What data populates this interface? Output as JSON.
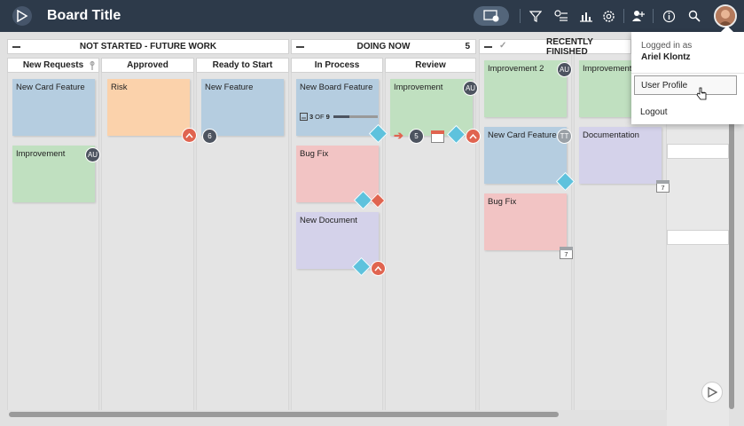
{
  "header": {
    "title": "Board Title",
    "icons": [
      "logo-icon",
      "board-view-icon",
      "filter-icon",
      "list-filter-icon",
      "analytics-icon",
      "settings-icon",
      "add-user-icon",
      "info-icon",
      "search-icon"
    ]
  },
  "lanes": [
    {
      "name": "NOT STARTED - FUTURE WORK",
      "count": ""
    },
    {
      "name": "DOING NOW",
      "count": "5"
    },
    {
      "name": "RECENTLY FINISHED",
      "count": ""
    }
  ],
  "columns": [
    {
      "name": "New Requests"
    },
    {
      "name": "Approved"
    },
    {
      "name": "Ready to Start"
    },
    {
      "name": "In Process"
    },
    {
      "name": "Review"
    }
  ],
  "cards": {
    "new_card_feature_1": "New Card Feature",
    "improvement_1": "Improvement",
    "risk": "Risk",
    "new_feature": "New Feature",
    "new_board_feature": "New Board Feature",
    "bug_fix_1": "Bug Fix",
    "new_document": "New Document",
    "improvement_review": "Improvement",
    "improvement_2": "Improvement 2",
    "improvement_partial": "Improvement",
    "new_card_feature_2": "New Card Feature",
    "documentation": "Documentation",
    "bug_fix_2": "Bug Fix"
  },
  "badges": {
    "au1": "AU",
    "au2": "AU",
    "au3": "AU",
    "tt": "TT",
    "count6": "6",
    "count5": "5",
    "cal7a": "7",
    "cal7b": "7"
  },
  "progress": {
    "done": "3",
    "of": "OF",
    "total": "9"
  },
  "user_menu": {
    "logged_in_as": "Logged in as",
    "user_name": "Ariel Klontz",
    "items": [
      "User Profile",
      "Logout"
    ]
  },
  "colors": {
    "topbar": "#2d3a4a",
    "blue_card": "#b5cde0",
    "orange_card": "#fbd2ab",
    "green_card": "#c0e0c0",
    "pink_card": "#f2c4c4",
    "lavender_card": "#d4d2ea",
    "alert_red": "#e06450",
    "tag_blue": "#5ec2dd"
  }
}
